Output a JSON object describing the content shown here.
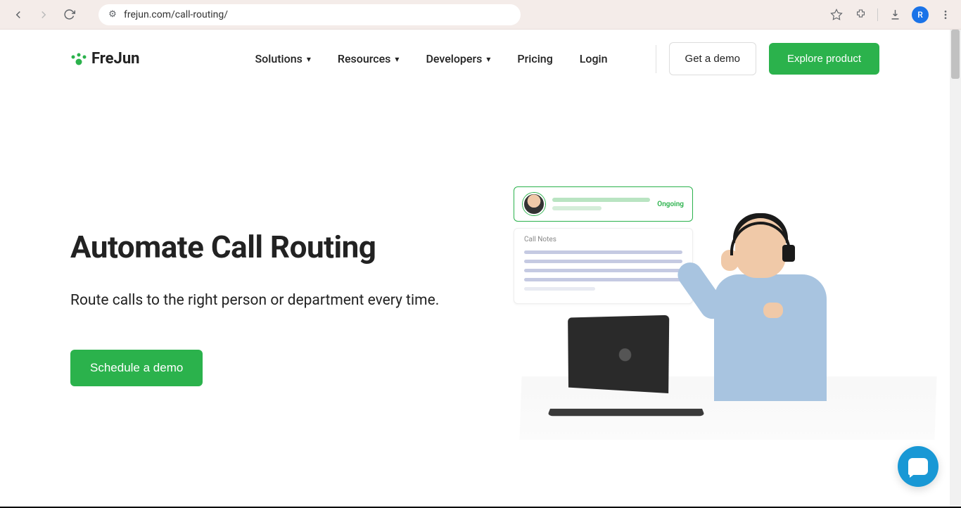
{
  "browser": {
    "url": "frejun.com/call-routing/",
    "profile_initial": "R"
  },
  "logo": {
    "text": "FreJun"
  },
  "nav": {
    "items": [
      {
        "label": "Solutions",
        "dropdown": true
      },
      {
        "label": "Resources",
        "dropdown": true
      },
      {
        "label": "Developers",
        "dropdown": true
      },
      {
        "label": "Pricing",
        "dropdown": false
      },
      {
        "label": "Login",
        "dropdown": false
      }
    ],
    "demo_button": "Get a demo",
    "explore_button": "Explore product"
  },
  "hero": {
    "title": "Automate Call Routing",
    "subtitle": "Route calls to the right person or department every time.",
    "cta": "Schedule a demo",
    "card_status": "Ongoing",
    "card_notes_title": "Call Notes"
  }
}
